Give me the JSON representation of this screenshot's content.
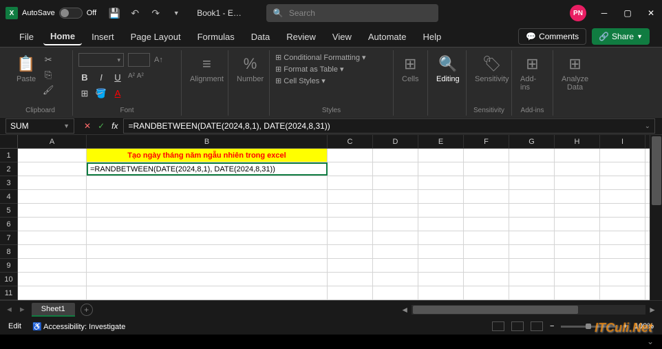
{
  "titlebar": {
    "autosave_label": "AutoSave",
    "autosave_state": "Off",
    "doc": "Book1 - E…",
    "search_placeholder": "Search",
    "avatar": "PN"
  },
  "tabs": {
    "items": [
      "File",
      "Home",
      "Insert",
      "Page Layout",
      "Formulas",
      "Data",
      "Review",
      "View",
      "Automate",
      "Help"
    ],
    "active": 1,
    "comments": "Comments",
    "share": "Share"
  },
  "ribbon": {
    "clipboard": {
      "label": "Clipboard",
      "paste": "Paste"
    },
    "font": {
      "label": "Font",
      "bold": "B",
      "italic": "I",
      "underline": "U"
    },
    "alignment": {
      "label": "Alignment"
    },
    "number": {
      "label": "Number"
    },
    "styles": {
      "label": "Styles",
      "cond": "Conditional Formatting",
      "table": "Format as Table",
      "cell": "Cell Styles"
    },
    "cells": {
      "label": "Cells"
    },
    "editing": {
      "label": "Editing"
    },
    "sensitivity": {
      "label": "Sensitivity"
    },
    "addins": {
      "label": "Add-ins"
    },
    "analyze": {
      "label": "Analyze Data"
    }
  },
  "formula_bar": {
    "name": "SUM",
    "formula": "=RANDBETWEEN(DATE(2024,8,1), DATE(2024,8,31))"
  },
  "grid": {
    "columns": [
      "A",
      "B",
      "C",
      "D",
      "E",
      "F",
      "G",
      "H",
      "I"
    ],
    "rows": [
      "1",
      "2",
      "3",
      "4",
      "5",
      "6",
      "7",
      "8",
      "9",
      "10",
      "11"
    ],
    "b1": "Tạo ngày tháng năm ngẫu nhiên trong excel",
    "b2": "=RANDBETWEEN(DATE(2024,8,1), DATE(2024,8,31))"
  },
  "sheets": {
    "active": "Sheet1"
  },
  "status": {
    "mode": "Edit",
    "accessibility": "Accessibility: Investigate",
    "zoom": "100%"
  },
  "watermark": "ITCuli.Net"
}
